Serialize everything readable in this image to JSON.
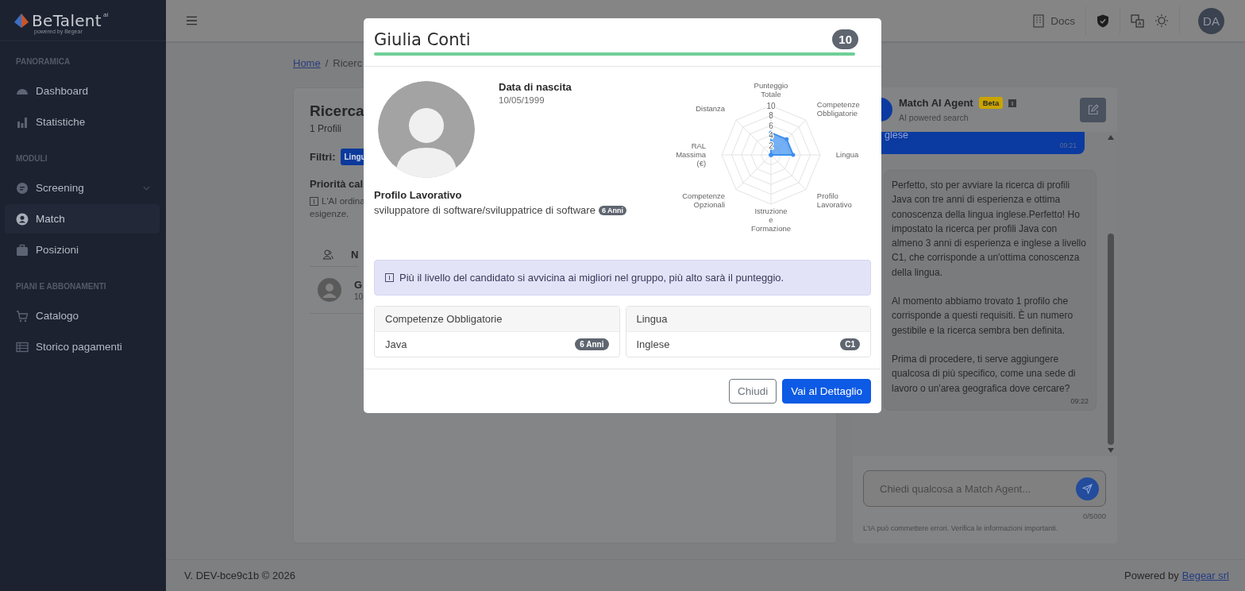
{
  "sidebar": {
    "logo": {
      "name": "BeTalent",
      "suffix": "ai",
      "tagline": "powered by Begear"
    },
    "sections": [
      {
        "title": "PANORAMICA",
        "items": [
          {
            "label": "Dashboard",
            "kind": "link",
            "selected": false
          },
          {
            "label": "Statistiche",
            "kind": "link",
            "selected": false
          }
        ]
      },
      {
        "title": "MODULI",
        "items": [
          {
            "label": "Screening",
            "kind": "group",
            "selected": false
          },
          {
            "label": "Match",
            "kind": "link",
            "selected": true
          },
          {
            "label": "Posizioni",
            "kind": "link",
            "selected": false
          }
        ]
      },
      {
        "title": "PIANI E ABBONAMENTI",
        "items": [
          {
            "label": "Catalogo",
            "kind": "link",
            "selected": false
          },
          {
            "label": "Storico pagamenti",
            "kind": "link",
            "selected": false
          }
        ]
      }
    ]
  },
  "topbar": {
    "docs_label": "Docs",
    "user_initials": "DA"
  },
  "breadcrumb": {
    "separator": "/",
    "items": [
      {
        "label": "Home",
        "kind": "link"
      },
      {
        "label": "Ricerc",
        "kind": "current"
      }
    ]
  },
  "search_card": {
    "title": "Ricerca",
    "count": "1 Profili",
    "filters_label": "Filtri:",
    "filter_chips": [
      "Lingu"
    ],
    "priority_title": "Priorità cal",
    "priority_note": [
      "L'AI ordina",
      "esigenze."
    ],
    "table_header": "N",
    "rows": [
      {
        "name": "G",
        "detail": "10"
      }
    ]
  },
  "chat": {
    "title": "Match AI Agent",
    "badge": "Beta",
    "subtitle": "AI powered search",
    "messages": [
      {
        "kind": "user",
        "paragraphs": [
          "glese"
        ],
        "time": "09:21"
      },
      {
        "kind": "assistant",
        "paragraphs": [
          "Perfetto, sto per avviare la ricerca di profili Java con tre anni di esperienza e ottima conoscenza della lingua inglese.Perfetto! Ho impostato la ricerca per profili Java con almeno 3 anni di esperienza e inglese a livello C1, che corrisponde a un'ottima conoscenza della lingua.",
          "Al momento abbiamo trovato 1 profilo che corrisponde a questi requisiti. È un numero gestibile e la ricerca sembra ben definita.",
          "Prima di procedere, ti serve aggiungere qualcosa di più specifico, come una sede di lavoro o un'area geografica dove cercare?"
        ],
        "time": "09:22"
      }
    ],
    "input": {
      "placeholder": "Chiedi qualcosa a Match Agent...",
      "counter": "0/5000"
    },
    "disclaimer": "L'IA può commettere errori. Verifica le informazioni importanti."
  },
  "footer": {
    "version": "V. DEV-bce9c1b © 2026",
    "powered_prefix": "Powered by",
    "powered_link": "Begear srl"
  },
  "modal": {
    "name": "Giulia Conti",
    "score": "10",
    "level": 1,
    "birth_label": "Data di nascita",
    "birth_date": "10/05/1999",
    "profile_label": "Profilo Lavorativo",
    "profile_text": "sviluppatore di software/sviluppatrice di software",
    "profile_badge": "6 Anni",
    "chart_data": {
      "type": "radar",
      "categories": [
        "Punteggio Totale",
        "Competenze Obbligatorie",
        "Lingua",
        "Profilo Lavorativo",
        "Istruzione e Formazione",
        "Competenze Opzionali",
        "RAL Massima (€)",
        "Distanza"
      ],
      "series": [
        {
          "color": "#3b8ff0",
          "values": [
            4.5,
            4.5,
            4.5,
            0,
            0,
            0,
            0,
            0
          ]
        }
      ],
      "ylim": [
        0,
        10
      ],
      "yticks": [
        2,
        4,
        6,
        8,
        10
      ]
    },
    "notice": "Più il livello del candidato si avvicina ai migliori nel gruppo, più alto sarà il punteggio.",
    "requirements": [
      {
        "title": "Competenze Obbligatorie",
        "items": [
          {
            "label": "Java",
            "badge": "6 Anni"
          }
        ]
      },
      {
        "title": "Lingua",
        "items": [
          {
            "label": "Inglese",
            "badge": "C1"
          }
        ]
      }
    ],
    "buttons": [
      {
        "label": "Chiudi",
        "kind": "secondary"
      },
      {
        "label": "Vai al Dettaglio",
        "kind": "primary"
      }
    ]
  }
}
